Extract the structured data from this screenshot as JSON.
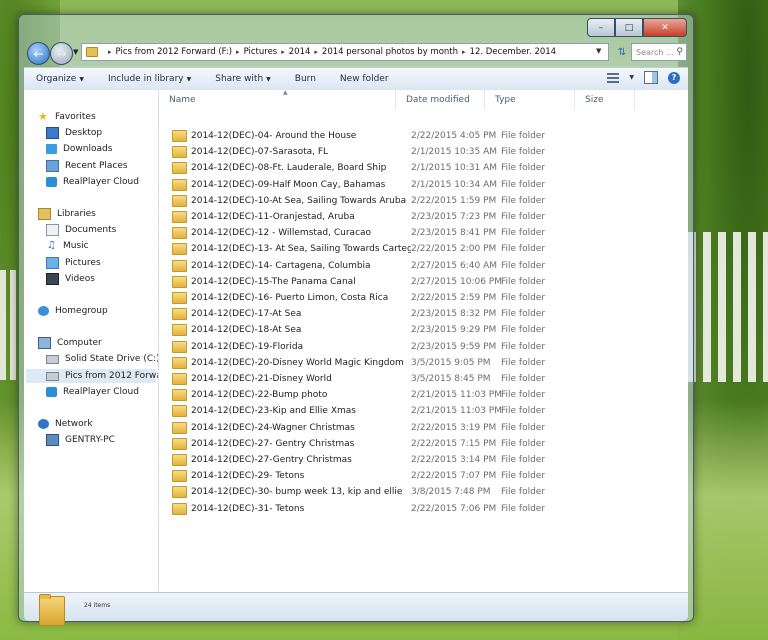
{
  "window": {
    "caption": {
      "minimize": "–",
      "maximize": "□",
      "close": "✕"
    }
  },
  "address": {
    "crumbs": [
      "Pics from 2012 Forward (F:)",
      "Pictures",
      "2014",
      "2014 personal photos by month",
      "12. December. 2014"
    ],
    "search_placeholder": "Search ..."
  },
  "toolbar": {
    "organize": "Organize",
    "include": "Include in library",
    "share": "Share with",
    "burn": "Burn",
    "newfolder": "New folder"
  },
  "nav": {
    "favorites": "Favorites",
    "desktop": "Desktop",
    "downloads": "Downloads",
    "recent": "Recent Places",
    "cloud1": "RealPlayer Cloud",
    "libraries": "Libraries",
    "documents": "Documents",
    "music": "Music",
    "pictures": "Pictures",
    "videos": "Videos",
    "homegroup": "Homegroup",
    "computer": "Computer",
    "drive_c": "Solid State Drive (C:)",
    "drive_f": "Pics from 2012 Forward (F:)",
    "cloud2": "RealPlayer Cloud",
    "network": "Network",
    "pc": "GENTRY-PC"
  },
  "columns": {
    "name": "Name",
    "date": "Date modified",
    "type": "Type",
    "size": "Size"
  },
  "files": [
    {
      "name": "2014-12(DEC)-04- Around the House",
      "date": "2/22/2015 4:05 PM",
      "type": "File folder"
    },
    {
      "name": "2014-12(DEC)-07-Sarasota, FL",
      "date": "2/1/2015 10:35 AM",
      "type": "File folder"
    },
    {
      "name": "2014-12(DEC)-08-Ft. Lauderale, Board Ship",
      "date": "2/1/2015 10:31 AM",
      "type": "File folder"
    },
    {
      "name": "2014-12(DEC)-09-Half Moon Cay, Bahamas",
      "date": "2/1/2015 10:34 AM",
      "type": "File folder"
    },
    {
      "name": "2014-12(DEC)-10-At Sea, Sailing Towards Aruba",
      "date": "2/22/2015 1:59 PM",
      "type": "File folder"
    },
    {
      "name": "2014-12(DEC)-11-Oranjestad, Aruba",
      "date": "2/23/2015 7:23 PM",
      "type": "File folder"
    },
    {
      "name": "2014-12(DEC)-12 - Willemstad, Curacao",
      "date": "2/23/2015 8:41 PM",
      "type": "File folder"
    },
    {
      "name": "2014-12(DEC)-13- At Sea, Sailing Towards Cartegena",
      "date": "2/22/2015 2:00 PM",
      "type": "File folder"
    },
    {
      "name": "2014-12(DEC)-14- Cartagena, Columbia",
      "date": "2/27/2015 6:40 AM",
      "type": "File folder"
    },
    {
      "name": "2014-12(DEC)-15-The Panama Canal",
      "date": "2/27/2015 10:06 PM",
      "type": "File folder"
    },
    {
      "name": "2014-12(DEC)-16- Puerto Limon, Costa Rica",
      "date": "2/22/2015 2:59 PM",
      "type": "File folder"
    },
    {
      "name": "2014-12(DEC)-17-At Sea",
      "date": "2/23/2015 8:32 PM",
      "type": "File folder"
    },
    {
      "name": "2014-12(DEC)-18-At Sea",
      "date": "2/23/2015 9:29 PM",
      "type": "File folder"
    },
    {
      "name": "2014-12(DEC)-19-Florida",
      "date": "2/23/2015 9:59 PM",
      "type": "File folder"
    },
    {
      "name": "2014-12(DEC)-20-Disney World Magic Kingdom",
      "date": "3/5/2015 9:05 PM",
      "type": "File folder"
    },
    {
      "name": "2014-12(DEC)-21-Disney World",
      "date": "3/5/2015 8:45 PM",
      "type": "File folder"
    },
    {
      "name": "2014-12(DEC)-22-Bump photo",
      "date": "2/21/2015 11:03 PM",
      "type": "File folder"
    },
    {
      "name": "2014-12(DEC)-23-Kip and Ellie Xmas",
      "date": "2/21/2015 11:03 PM",
      "type": "File folder"
    },
    {
      "name": "2014-12(DEC)-24-Wagner Christmas",
      "date": "2/22/2015 3:19 PM",
      "type": "File folder"
    },
    {
      "name": "2014-12(DEC)-27- Gentry Christmas",
      "date": "2/22/2015 7:15 PM",
      "type": "File folder"
    },
    {
      "name": "2014-12(DEC)-27-Gentry Christmas",
      "date": "2/22/2015 3:14 PM",
      "type": "File folder"
    },
    {
      "name": "2014-12(DEC)-29- Tetons",
      "date": "2/22/2015 7:07 PM",
      "type": "File folder"
    },
    {
      "name": "2014-12(DEC)-30- bump week 13, kip and ellie",
      "date": "3/8/2015 7:48 PM",
      "type": "File folder"
    },
    {
      "name": "2014-12(DEC)-31- Tetons",
      "date": "2/22/2015 7:06 PM",
      "type": "File folder"
    }
  ],
  "status": {
    "count": "24 items"
  },
  "icons": {
    "back": "back-arrow-icon",
    "forward": "forward-arrow-icon",
    "refresh": "refresh-icon",
    "search": "search-icon",
    "views": "views-icon",
    "preview": "preview-pane-icon",
    "help": "help-icon",
    "folder": "folder-icon"
  }
}
